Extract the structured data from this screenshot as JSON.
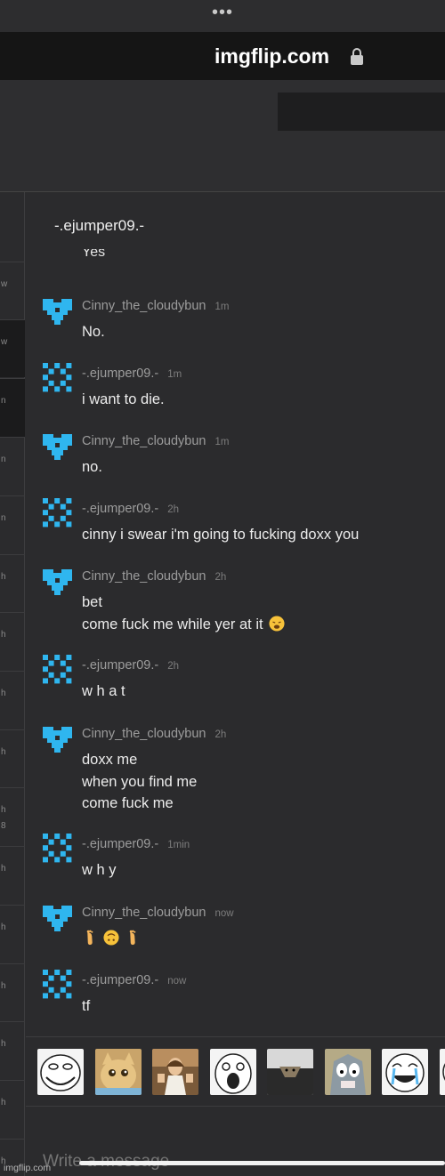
{
  "browser": {
    "menu_dots": "•••",
    "url": "imgflip.com",
    "lock_icon": "lock-icon"
  },
  "left_list": {
    "items": [
      {
        "label": "w",
        "selected": false
      },
      {
        "label": "w",
        "selected": true
      },
      {
        "label": "n",
        "selected": true
      },
      {
        "label": "n",
        "selected": false
      },
      {
        "label": "n",
        "selected": false
      },
      {
        "label": "h",
        "selected": false
      },
      {
        "label": "h",
        "selected": false
      },
      {
        "label": "h",
        "selected": false
      },
      {
        "label": "h",
        "selected": false
      },
      {
        "label": "h\n8",
        "selected": false
      },
      {
        "label": "h",
        "selected": false
      },
      {
        "label": "h",
        "selected": false
      },
      {
        "label": "h",
        "selected": false
      },
      {
        "label": "h",
        "selected": false
      },
      {
        "label": "h",
        "selected": false
      },
      {
        "label": "h",
        "selected": false
      }
    ]
  },
  "chat": {
    "title": "-.ejumper09.-",
    "partial_message": "Yes",
    "messages": [
      {
        "user": "Cinny_the_cloudybun",
        "time": "1m",
        "text": "No.",
        "avatar": "heart"
      },
      {
        "user": "-.ejumper09.-",
        "time": "1m",
        "text": "i want to die.",
        "avatar": "checker"
      },
      {
        "user": "Cinny_the_cloudybun",
        "time": "1m",
        "text": "no.",
        "avatar": "heart"
      },
      {
        "user": "-.ejumper09.-",
        "time": "2h",
        "text": "cinny i swear i'm going to fucking doxx you",
        "avatar": "checker"
      },
      {
        "user": "Cinny_the_cloudybun",
        "time": "2h",
        "text": "bet\ncome fuck me while yer at it",
        "emoji": "weary-face-emoji",
        "avatar": "heart"
      },
      {
        "user": "-.ejumper09.-",
        "time": "2h",
        "text": "w h a t",
        "avatar": "checker"
      },
      {
        "user": "Cinny_the_cloudybun",
        "time": "2h",
        "text": "doxx me\nwhen you find me\ncome fuck me",
        "avatar": "heart"
      },
      {
        "user": "-.ejumper09.-",
        "time": "1min",
        "text": "w h y",
        "avatar": "checker"
      },
      {
        "user": "Cinny_the_cloudybun",
        "time": "now",
        "text": "",
        "emoji_row": [
          "foot-emoji",
          "upside-down-face-emoji",
          "foot-emoji"
        ],
        "avatar": "heart"
      },
      {
        "user": "-.ejumper09.-",
        "time": "now",
        "text": "tf",
        "avatar": "checker"
      }
    ]
  },
  "stickers": [
    "troll-face-sticker",
    "crying-cat-sticker",
    "buddy-christ-sticker",
    "rage-face-sticker",
    "ceiling-cat-sticker",
    "shocked-tom-sticker",
    "happy-cry-face-sticker",
    "partial-sticker"
  ],
  "composer": {
    "placeholder": "Write a message"
  },
  "watermark": "imgflip.com",
  "colors": {
    "avatar": "#2fb6ef",
    "background": "#2b2b2d"
  }
}
